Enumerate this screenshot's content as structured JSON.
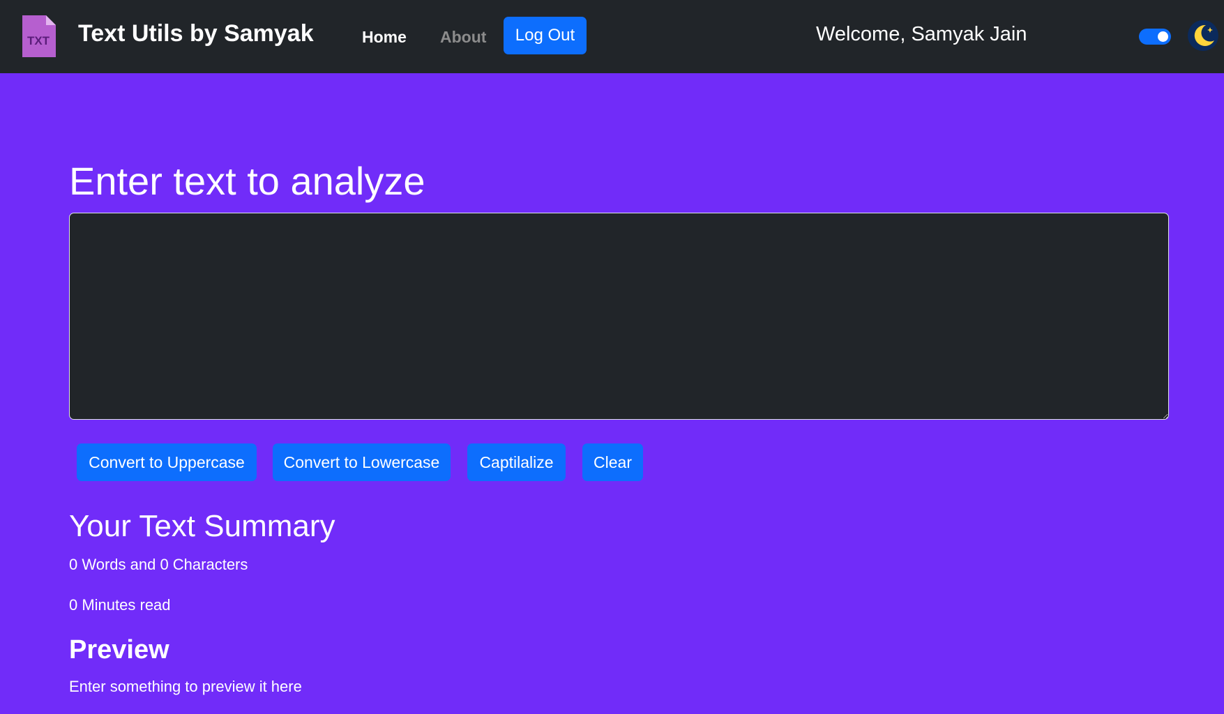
{
  "navbar": {
    "logo_text": "TXT",
    "brand": "Text Utils by Samyak",
    "links": [
      {
        "label": "Home"
      },
      {
        "label": "About"
      }
    ],
    "logout_label": "Log Out",
    "welcome": "Welcome, Samyak Jain",
    "dark_mode_enabled": true,
    "icons": [
      "txt-file-icon",
      "moon-icon"
    ]
  },
  "main": {
    "heading": "Enter text to analyze",
    "textarea_value": "",
    "buttons": [
      {
        "label": "Convert to Uppercase"
      },
      {
        "label": "Convert to Lowercase"
      },
      {
        "label": "Captilalize"
      },
      {
        "label": "Clear"
      }
    ]
  },
  "summary": {
    "title": "Your Text Summary",
    "words_chars": "0 Words and 0 Characters",
    "read_time": "0 Minutes read",
    "preview_title": "Preview",
    "preview_text": "Enter something to preview it here"
  },
  "colors": {
    "page_background": "#712cf9",
    "navbar": "#212529",
    "button_primary": "#0d6efd",
    "textarea_background": "#212529"
  }
}
